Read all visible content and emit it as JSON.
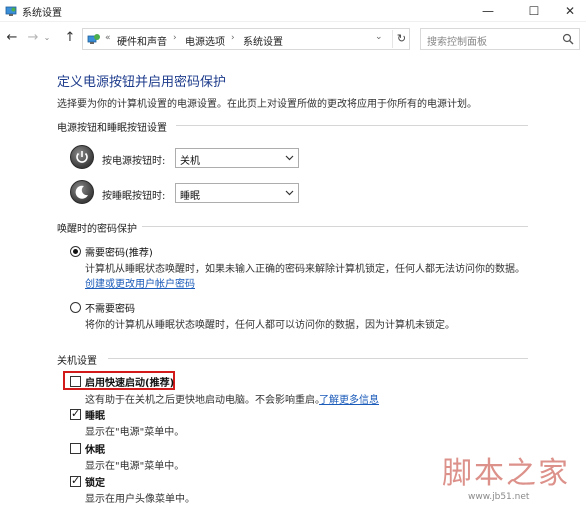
{
  "window": {
    "title": "系统设置",
    "min_glyph": "—",
    "max_glyph": "☐",
    "close_glyph": "✕"
  },
  "nav": {
    "back_glyph": "←",
    "forward_glyph": "→",
    "recent_glyph": "⌄",
    "up_glyph": "↑",
    "overflow": "«",
    "breadcrumb": [
      "硬件和声音",
      "电源选项",
      "系统设置"
    ],
    "separator": "›",
    "refresh_glyph": "↻",
    "search_placeholder": "搜索控制面板"
  },
  "page": {
    "title": "定义电源按钮并启用密码保护",
    "description": "选择要为你的计算机设置的电源设置。在此页上对设置所做的更改将应用于你所有的电源计划。"
  },
  "power_buttons": {
    "heading": "电源按钮和睡眠按钮设置",
    "power_label": "按电源按钮时:",
    "power_value": "关机",
    "sleep_label": "按睡眠按钮时:",
    "sleep_value": "睡眠"
  },
  "wake_password": {
    "heading": "唤醒时的密码保护",
    "require_label": "需要密码(推荐)",
    "require_desc": "计算机从睡眠状态唤醒时，如果未输入正确的密码来解除计算机锁定，任何人都无法访问你的数据。",
    "require_link": "创建或更改用户帐户密码",
    "norequire_label": "不需要密码",
    "norequire_desc": "将你的计算机从睡眠状态唤醒时，任何人都可以访问你的数据，因为计算机未锁定。"
  },
  "shutdown": {
    "heading": "关机设置",
    "fast_label": "启用快速启动(推荐)",
    "fast_desc": "这有助于在关机之后更快地启动电脑。不会影响重启。",
    "fast_link": "了解更多信息",
    "sleep_label": "睡眠",
    "sleep_desc": "显示在\"电源\"菜单中。",
    "hibernate_label": "休眠",
    "hibernate_desc": "显示在\"电源\"菜单中。",
    "lock_label": "锁定",
    "lock_desc": "显示在用户头像菜单中。",
    "check_glyph": "✓"
  },
  "watermark": {
    "brand": "脚本之家",
    "url": "www.jb51.net"
  },
  "colors": {
    "title_blue": "#1e3c8c",
    "link_blue": "#1a5ab8",
    "highlight_red": "#d21a1a"
  }
}
